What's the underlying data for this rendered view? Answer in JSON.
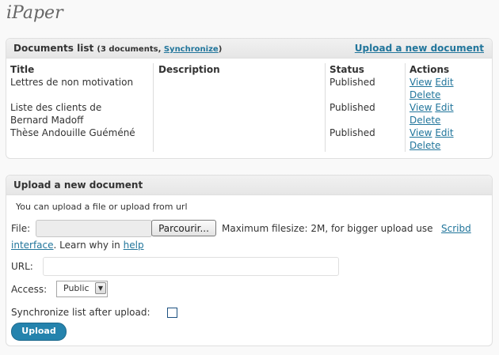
{
  "page": {
    "title": "iPaper"
  },
  "documents": {
    "heading": "Documents list",
    "count": "3 documents",
    "synchronize_label": "Synchronize",
    "upload_link": "Upload a new document",
    "columns": [
      "Title",
      "Description",
      "Status",
      "Actions"
    ],
    "rows": [
      {
        "title": "Lettres de non motivation",
        "description": "",
        "status": "Published"
      },
      {
        "title": "Liste des clients de Bernard Madoff",
        "description": "",
        "status": "Published"
      },
      {
        "title": "Thèse Andouille Guéméné",
        "description": "",
        "status": "Published"
      }
    ],
    "actions": {
      "view": "View",
      "edit": "Edit",
      "delete": "Delete"
    }
  },
  "upload": {
    "heading": "Upload a new document",
    "intro": "You can upload a file or upload from url",
    "file_label": "File:",
    "browse_label": "Parcourir...",
    "filesize_text": "Maximum filesize: 2M, for bigger upload use",
    "scribd_link": "Scribd interface",
    "learn_text": ". Learn why in",
    "help_link": "help",
    "url_label": "URL:",
    "url_value": "",
    "access_label": "Access:",
    "access_value": "Public",
    "sync_label": "Synchronize list after upload:",
    "sync_checked": false,
    "submit_label": "Upload"
  }
}
